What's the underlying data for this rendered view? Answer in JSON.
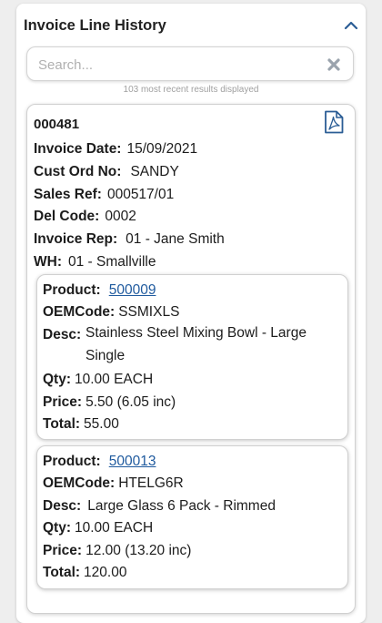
{
  "panel": {
    "title": "Invoice Line History"
  },
  "search": {
    "placeholder": "Search...",
    "value": ""
  },
  "results_note": "103 most recent results displayed",
  "invoice": {
    "number": "000481",
    "fields": {
      "invoice_date": {
        "label": "Invoice Date:",
        "value": "15/09/2021"
      },
      "cust_ord_no": {
        "label": "Cust Ord No:",
        "value": "SANDY"
      },
      "sales_ref": {
        "label": "Sales Ref:",
        "value": "000517/01"
      },
      "del_code": {
        "label": "Del Code:",
        "value": "0002"
      },
      "invoice_rep": {
        "label": "Invoice Rep:",
        "value": "01 - Jane Smith"
      },
      "wh": {
        "label": "WH:",
        "value": "01 - Smallville"
      }
    },
    "lines": [
      {
        "product_label": "Product:",
        "product": "500009",
        "oem_label": "OEMCode:",
        "oem": "SSMIXLS",
        "desc_label": "Desc:",
        "desc": "Stainless Steel Mixing Bowl - Large Single",
        "qty_label": "Qty:",
        "qty": "10.00 EACH",
        "price_label": "Price:",
        "price": "5.50 (6.05 inc)",
        "total_label": "Total:",
        "total": "55.00"
      },
      {
        "product_label": "Product:",
        "product": "500013",
        "oem_label": "OEMCode:",
        "oem": "HTELG6R",
        "desc_label": "Desc:",
        "desc": "Large Glass 6 Pack - Rimmed",
        "qty_label": "Qty:",
        "qty": "10.00 EACH",
        "price_label": "Price:",
        "price": "12.00 (13.20 inc)",
        "total_label": "Total:",
        "total": "120.00"
      }
    ]
  },
  "icons": {
    "collapse": "chevron-up-icon",
    "clear": "close-icon",
    "pdf": "pdf-file-icon"
  },
  "colors": {
    "link": "#1f5a9e",
    "icon": "#2b5d95",
    "clear_icon": "#9aa3ad"
  }
}
